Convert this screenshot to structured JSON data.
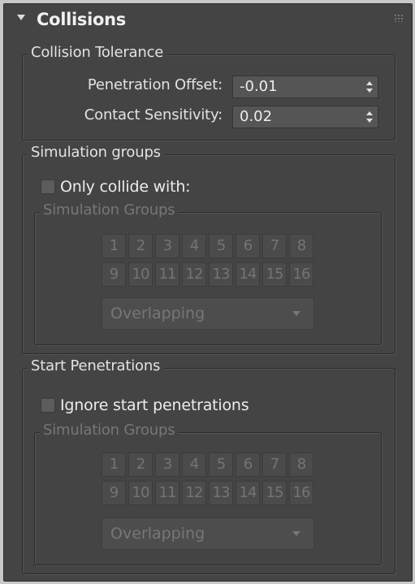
{
  "rollout": {
    "title": "Collisions"
  },
  "collision_tolerance": {
    "title": "Collision Tolerance",
    "penetration_offset": {
      "label": "Penetration Offset:",
      "value": "-0.01"
    },
    "contact_sensitivity": {
      "label": "Contact Sensitivity:",
      "value": "0.02"
    }
  },
  "simulation_groups": {
    "title": "Simulation groups",
    "only_collide": {
      "label": "Only collide with:",
      "checked": false
    },
    "subgroup": {
      "title": "Simulation Groups",
      "buttons": [
        "1",
        "2",
        "3",
        "4",
        "5",
        "6",
        "7",
        "8",
        "9",
        "10",
        "11",
        "12",
        "13",
        "14",
        "15",
        "16"
      ],
      "mode": "Overlapping"
    }
  },
  "start_penetrations": {
    "title": "Start Penetrations",
    "ignore": {
      "label": "Ignore start penetrations",
      "checked": false
    },
    "subgroup": {
      "title": "Simulation Groups",
      "buttons": [
        "1",
        "2",
        "3",
        "4",
        "5",
        "6",
        "7",
        "8",
        "9",
        "10",
        "11",
        "12",
        "13",
        "14",
        "15",
        "16"
      ],
      "mode": "Overlapping"
    }
  }
}
